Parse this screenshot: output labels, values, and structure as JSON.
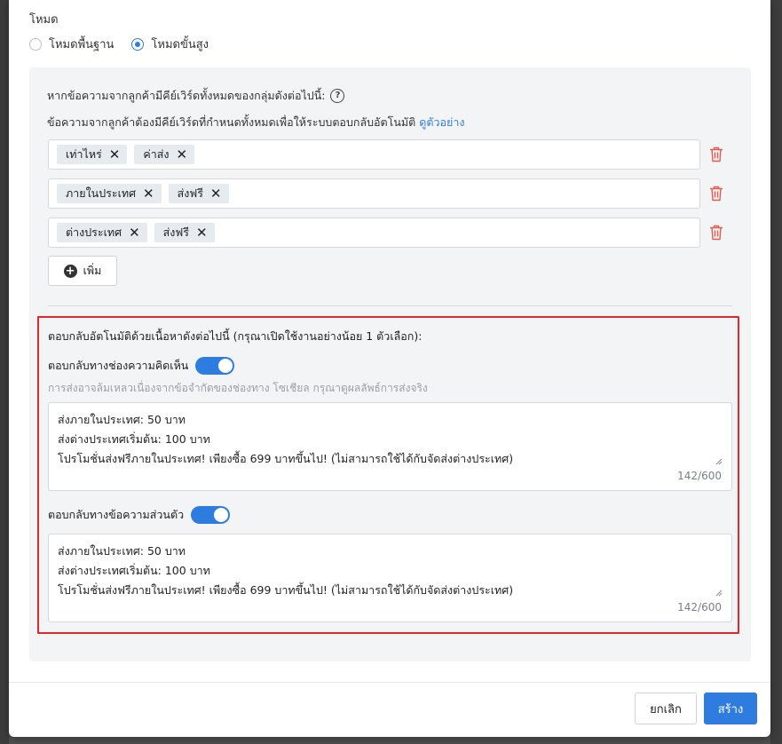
{
  "mode": {
    "label": "โหมด",
    "options": [
      "โหมดพื้นฐาน",
      "โหมดขั้นสูง"
    ],
    "selected": "โหมดขั้นสูง"
  },
  "conditions": {
    "line1": "หากข้อความจากลูกค้ามีคีย์เวิร์ดทั้งหมดของกลุ่มดังต่อไปนี้:",
    "line2": "ข้อความจากลูกค้าต้องมีคีย์เวิร์ดที่กำหนดทั้งหมดเพื่อให้ระบบตอบกลับอัตโนมัติ",
    "example_link": "ดูตัวอย่าง",
    "groups": [
      [
        "เท่าไหร่",
        "ค่าส่ง"
      ],
      [
        "ภายในประเทศ",
        "ส่งฟรี"
      ],
      [
        "ต่างประเทศ",
        "ส่งฟรี"
      ]
    ],
    "add_label": "เพิ่ม"
  },
  "reply": {
    "title": "ตอบกลับอัตโนมัติด้วยเนื้อหาดังต่อไปนี้ (กรุณาเปิดใช้งานอย่างน้อย 1 ตัวเลือก):",
    "comment": {
      "label": "ตอบกลับทางช่องความคิดเห็น",
      "enabled": true,
      "warning": "การส่งอาจล้มเหลวเนื่องจากข้อจำกัดของช่องทาง โซเชียล กรุณาดูผลลัพธ์การส่งจริง",
      "lines": [
        "ส่งภายในประเทศ: 50 บาท",
        "ส่งต่างประเทศเริ่มต้น: 100 บาท",
        "โปรโมชั่นส่งฟรีภายในประเทศ! เพียงซื้อ 699 บาทขึ้นไป! (ไม่สามารถใช้ได้กับจัดส่งต่างประเทศ)"
      ],
      "counter": "142/600"
    },
    "private": {
      "label": "ตอบกลับทางข้อความส่วนตัว",
      "enabled": true,
      "lines": [
        "ส่งภายในประเทศ: 50 บาท",
        "ส่งต่างประเทศเริ่มต้น: 100 บาท",
        "โปรโมชั่นส่งฟรีภายในประเทศ! เพียงซื้อ 699 บาทขึ้นไป! (ไม่สามารถใช้ได้กับจัดส่งต่างประเทศ)"
      ],
      "counter": "142/600"
    }
  },
  "footer": {
    "cancel": "ยกเลิก",
    "create": "สร้าง"
  },
  "colors": {
    "primary": "#2f7ce0",
    "highlight_border": "#e0292b",
    "delete_icon": "#e45b50"
  }
}
